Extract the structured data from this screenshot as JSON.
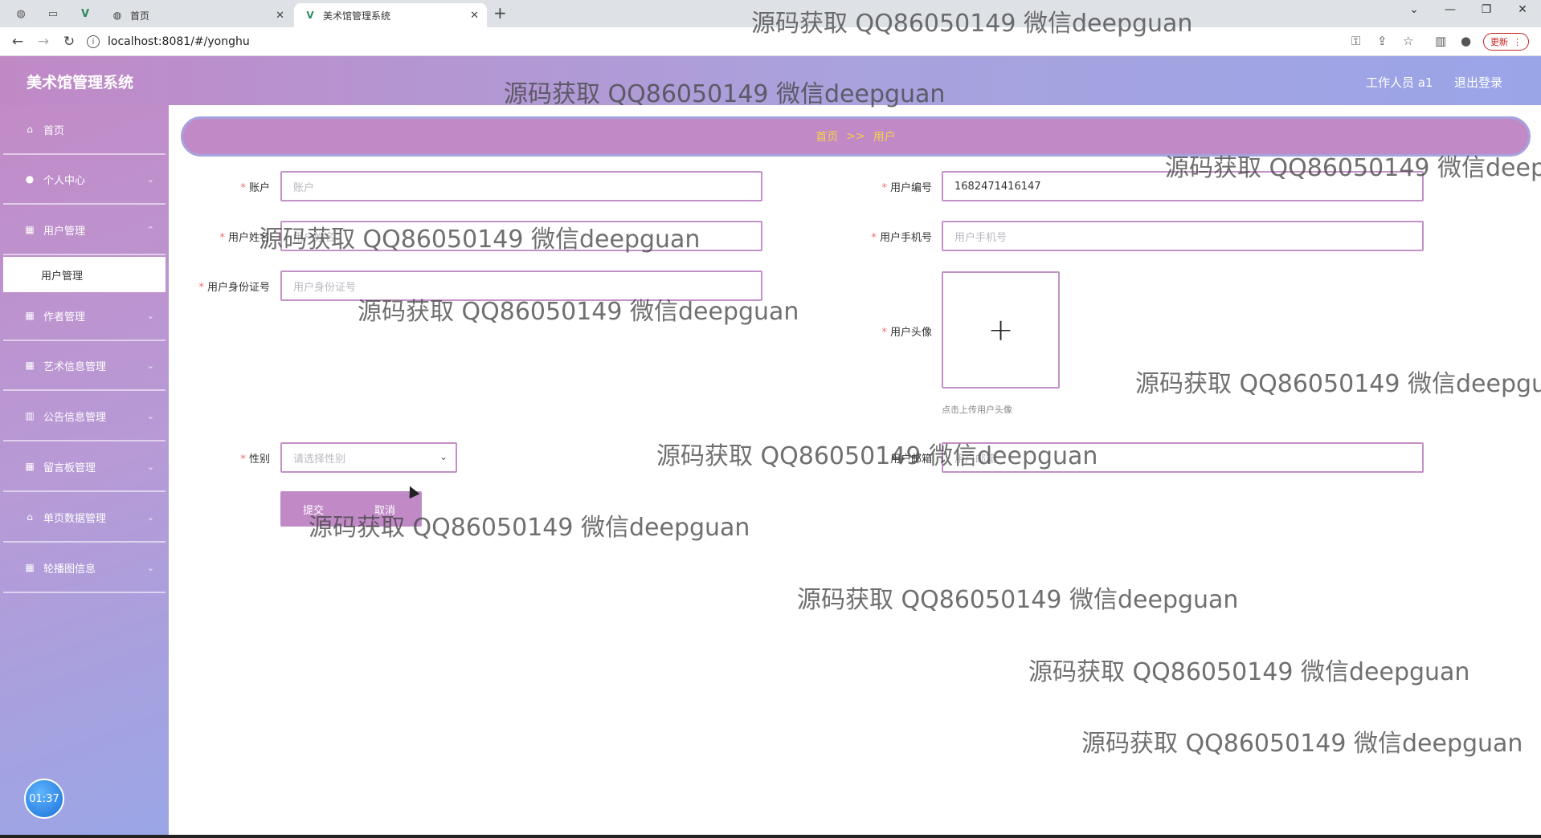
{
  "browser": {
    "tabs": [
      {
        "label": "首页",
        "active": false
      },
      {
        "label": "美术馆管理系统",
        "active": true
      }
    ],
    "url": "localhost:8081/#/yonghu",
    "update_label": "更新"
  },
  "header": {
    "title": "美术馆管理系统",
    "user": "工作人员 a1",
    "logout": "退出登录"
  },
  "sidebar": {
    "items": [
      {
        "label": "首页",
        "icon": "home-icon"
      },
      {
        "label": "个人中心",
        "icon": "user-icon"
      },
      {
        "label": "用户管理",
        "icon": "grid-icon"
      },
      {
        "label": "作者管理",
        "icon": "grid-icon"
      },
      {
        "label": "艺术信息管理",
        "icon": "grid-icon"
      },
      {
        "label": "公告信息管理",
        "icon": "chart-icon"
      },
      {
        "label": "留言板管理",
        "icon": "grid-icon"
      },
      {
        "label": "单页数据管理",
        "icon": "bank-icon"
      },
      {
        "label": "轮播图信息",
        "icon": "grid-icon"
      }
    ],
    "active_sub": "用户管理",
    "clock": "01:37"
  },
  "breadcrumb": {
    "home": "首页",
    "separator": ">>",
    "current": "用户"
  },
  "form": {
    "account": {
      "label": "账户",
      "placeholder": "账户",
      "value": ""
    },
    "user_no": {
      "label": "用户编号",
      "value": "1682471416147"
    },
    "user_name": {
      "label": "用户姓名",
      "placeholder": "用户姓名",
      "value": ""
    },
    "user_phone": {
      "label": "用户手机号",
      "placeholder": "用户手机号",
      "value": ""
    },
    "user_id_card": {
      "label": "用户身份证号",
      "placeholder": "用户身份证号",
      "value": ""
    },
    "avatar": {
      "label": "用户头像",
      "hint": "点击上传用户头像"
    },
    "gender": {
      "label": "性别",
      "placeholder": "请选择性别"
    },
    "email": {
      "label": "用户邮箱",
      "placeholder": "用户邮箱",
      "value": ""
    },
    "submit": "提交",
    "cancel": "取消"
  },
  "watermark": "源码获取 QQ86050149 微信deepguan"
}
